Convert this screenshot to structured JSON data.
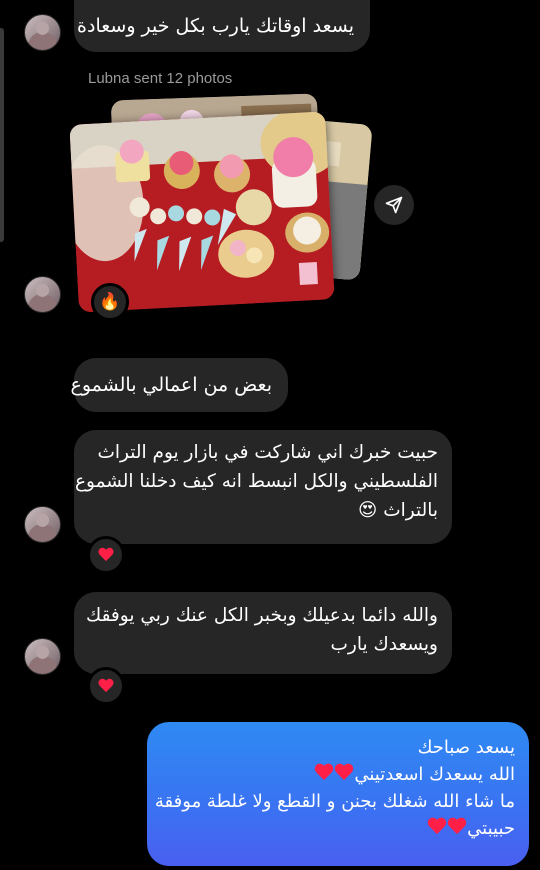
{
  "thread": {
    "sent_label": "Lubna sent 12 photos",
    "reaction_fire": "🔥"
  },
  "messages": {
    "m1": "يسعد اوقاتك يارب بكل خير وسعادة",
    "m2": "بعض من اعمالي بالشموع",
    "m3_line1": "حبيت خبرك اني شاركت في بازار  يوم التراث",
    "m3_line2": "الفلسطيني والكل انبسط انه كيف دخلنا الشموع",
    "m3_line3": "بالتراث",
    "m3_emoji": "😍",
    "m4_line1": "والله دائما بدعيلك وبخبر الكل عنك ربي يوفقك",
    "m4_line2": "ويسعدك يارب",
    "out_line1": "يسعد صباحك",
    "out_line2": "الله يسعدك اسعدتيني",
    "out_line3": "ما شاء الله شغلك بجنن و القطع ولا غلطة موفقة",
    "out_line4": "حبيبتي"
  },
  "colors": {
    "incoming_bubble": "#262626",
    "outgoing_gradient_top": "#2f8af3",
    "outgoing_gradient_bottom": "#4a5ff0",
    "heart": "#ff1f47"
  }
}
